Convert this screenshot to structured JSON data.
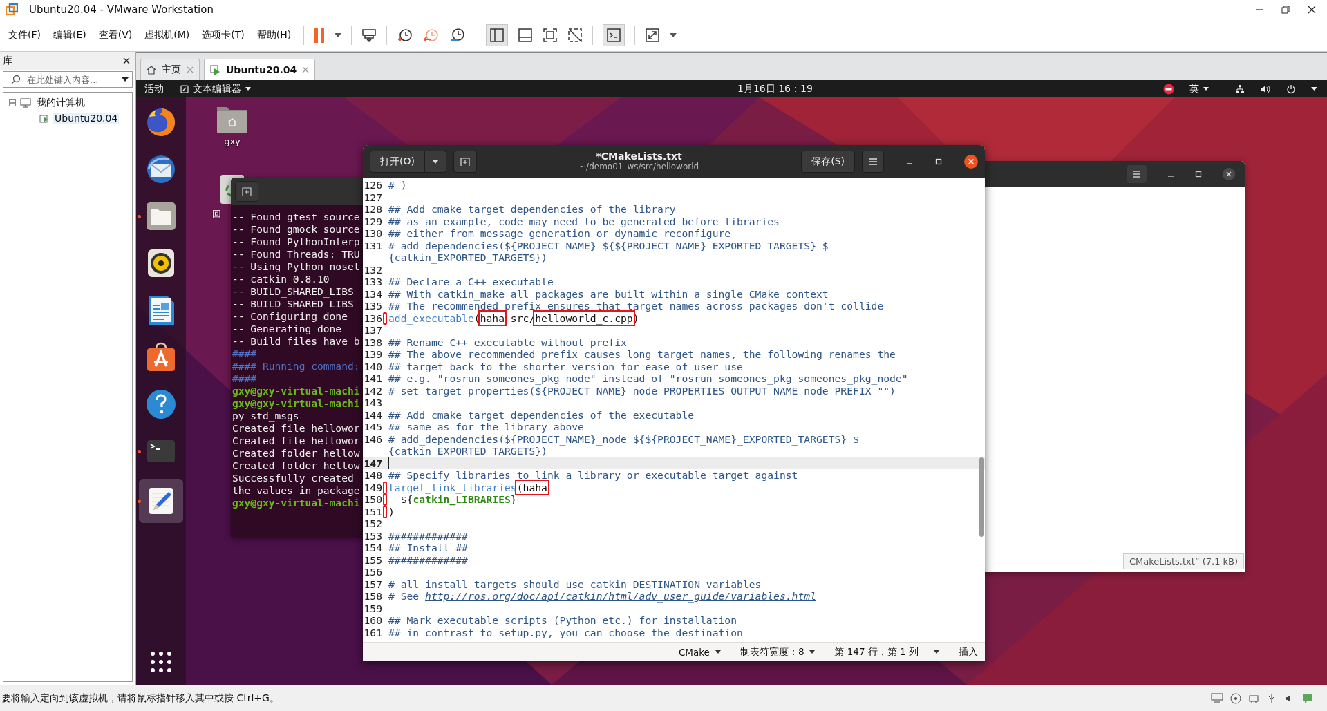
{
  "window": {
    "title": "Ubuntu20.04 - VMware Workstation"
  },
  "menu": [
    "文件(F)",
    "编辑(E)",
    "查看(V)",
    "虚拟机(M)",
    "选项卡(T)",
    "帮助(H)"
  ],
  "library": {
    "title": "库",
    "search": {
      "placeholder": "在此处键入内容..."
    },
    "tree": [
      {
        "label": "我的计算机",
        "expanded": true,
        "selected": false,
        "children": [
          {
            "label": "Ubuntu20.04",
            "selected": true
          }
        ]
      }
    ]
  },
  "tabs": [
    {
      "label": "主页",
      "kind": "home",
      "selected": false
    },
    {
      "label": "Ubuntu20.04",
      "kind": "vm",
      "selected": true
    }
  ],
  "guest": {
    "top_bar": {
      "activities": "活动",
      "app_menu": "文本编辑器",
      "clock": "1月16日 16：19",
      "input_method": "英"
    },
    "dock": [
      {
        "kind": "browser",
        "running": false,
        "selected": false
      },
      {
        "kind": "mail",
        "running": false,
        "selected": false
      },
      {
        "kind": "files",
        "running": true,
        "selected": false
      },
      {
        "kind": "music",
        "running": false,
        "selected": false
      },
      {
        "kind": "writer",
        "running": false,
        "selected": false
      },
      {
        "kind": "software",
        "running": false,
        "selected": false
      },
      {
        "kind": "help",
        "running": false,
        "selected": false
      },
      {
        "kind": "terminal",
        "running": true,
        "selected": false
      },
      {
        "kind": "editor",
        "running": true,
        "selected": true
      }
    ],
    "desktop_icons": [
      {
        "label": "gxy",
        "kind": "home"
      },
      {
        "label": "回",
        "kind": "trash"
      }
    ],
    "terminal": {
      "lines": [
        {
          "text": "-- Found gtest source",
          "kind": "output"
        },
        {
          "text": "-- Found gmock source",
          "kind": "output"
        },
        {
          "text": "-- Found PythonInterp",
          "kind": "output"
        },
        {
          "text": "-- Found Threads: TRU",
          "kind": "output"
        },
        {
          "text": "-- Using Python noset",
          "kind": "output"
        },
        {
          "text": "-- catkin 0.8.10",
          "kind": "output"
        },
        {
          "text": "-- BUILD_SHARED_LIBS",
          "kind": "output"
        },
        {
          "text": "-- BUILD_SHARED_LIBS",
          "kind": "output"
        },
        {
          "text": "-- Configuring done",
          "kind": "output"
        },
        {
          "text": "-- Generating done",
          "kind": "output"
        },
        {
          "text": "-- Build files have b",
          "kind": "output"
        },
        {
          "text": "####",
          "kind": "banner"
        },
        {
          "text": "#### Running command:",
          "kind": "banner"
        },
        {
          "text": "####",
          "kind": "banner"
        },
        {
          "text": "gxy@gxy-virtual-machi",
          "kind": "prompt"
        },
        {
          "text": "gxy@gxy-virtual-machi",
          "kind": "prompt"
        },
        {
          "text": "py std_msgs",
          "kind": "output"
        },
        {
          "text": "Created file hellowor",
          "kind": "output"
        },
        {
          "text": "Created file hellowor",
          "kind": "output"
        },
        {
          "text": "Created folder hellow",
          "kind": "output"
        },
        {
          "text": "Created folder hellow",
          "kind": "output"
        },
        {
          "text": "Successfully created",
          "kind": "output"
        },
        {
          "text": "the values in package",
          "kind": "output"
        },
        {
          "text": "gxy@gxy-virtual-machi",
          "kind": "prompt"
        }
      ]
    },
    "editor": {
      "title": "*CMakeLists.txt",
      "subtitle": "~/demo01_ws/src/helloworld",
      "open_button": "打开(O)",
      "save_button": "保存(S)",
      "lines": [
        {
          "num": "126",
          "current": false,
          "marked": false,
          "segments": [
            {
              "text": "# )",
              "kind": "comment"
            }
          ]
        },
        {
          "num": "127",
          "current": false,
          "marked": false
        },
        {
          "num": "128",
          "current": false,
          "marked": false,
          "segments": [
            {
              "text": "## Add cmake target dependencies of the library",
              "kind": "comment"
            }
          ]
        },
        {
          "num": "129",
          "current": false,
          "marked": false,
          "segments": [
            {
              "text": "## as an example, code may need to be generated before libraries",
              "kind": "comment"
            }
          ]
        },
        {
          "num": "130",
          "current": false,
          "marked": false,
          "segments": [
            {
              "text": "## either from message generation or dynamic reconfigure",
              "kind": "comment"
            }
          ]
        },
        {
          "num": "131",
          "current": false,
          "marked": false,
          "segments": [
            {
              "text": "# add_dependencies(${PROJECT_NAME} ${${PROJECT_NAME}_EXPORTED_TARGETS} $",
              "kind": "comment"
            }
          ],
          "wrap": "{catkin_EXPORTED_TARGETS})"
        },
        {
          "num": "132",
          "current": false,
          "marked": false
        },
        {
          "num": "133",
          "current": false,
          "marked": false,
          "segments": [
            {
              "text": "## Declare a C++ executable",
              "kind": "comment"
            }
          ]
        },
        {
          "num": "134",
          "current": false,
          "marked": false,
          "segments": [
            {
              "text": "## With catkin_make all packages are built within a single CMake context",
              "kind": "comment"
            }
          ]
        },
        {
          "num": "135",
          "current": false,
          "marked": false,
          "segments": [
            {
              "text": "## The recommended prefix ensures that target names across packages don't collide",
              "kind": "comment"
            }
          ]
        },
        {
          "num": "136",
          "current": false,
          "marked": true,
          "segments": [
            {
              "text": "add_executable",
              "kind": "function",
              "boxed": false
            },
            {
              "text": "(",
              "kind": "plain",
              "boxed": false
            },
            {
              "text": "haha",
              "kind": "plain",
              "boxed": true
            },
            {
              "text": " src/",
              "kind": "plain",
              "boxed": false
            },
            {
              "text": "helloworld_c.cpp",
              "kind": "plain",
              "boxed": true
            },
            {
              "text": ")",
              "kind": "plain",
              "boxed": false
            }
          ]
        },
        {
          "num": "137",
          "current": false,
          "marked": false
        },
        {
          "num": "138",
          "current": false,
          "marked": false,
          "segments": [
            {
              "text": "## Rename C++ executable without prefix",
              "kind": "comment"
            }
          ]
        },
        {
          "num": "139",
          "current": false,
          "marked": false,
          "segments": [
            {
              "text": "## The above recommended prefix causes long target names, the following renames the",
              "kind": "comment"
            }
          ]
        },
        {
          "num": "140",
          "current": false,
          "marked": false,
          "segments": [
            {
              "text": "## target back to the shorter version for ease of user use",
              "kind": "comment"
            }
          ]
        },
        {
          "num": "141",
          "current": false,
          "marked": false,
          "segments": [
            {
              "text": "## e.g. \"rosrun someones_pkg node\" instead of \"rosrun someones_pkg someones_pkg_node\"",
              "kind": "comment"
            }
          ]
        },
        {
          "num": "142",
          "current": false,
          "marked": false,
          "segments": [
            {
              "text": "# set_target_properties(${PROJECT_NAME}_node PROPERTIES OUTPUT_NAME node PREFIX \"\")",
              "kind": "comment"
            }
          ]
        },
        {
          "num": "143",
          "current": false,
          "marked": false
        },
        {
          "num": "144",
          "current": false,
          "marked": false,
          "segments": [
            {
              "text": "## Add cmake target dependencies of the executable",
              "kind": "comment"
            }
          ]
        },
        {
          "num": "145",
          "current": false,
          "marked": false,
          "segments": [
            {
              "text": "## same as for the library above",
              "kind": "comment"
            }
          ]
        },
        {
          "num": "146",
          "current": false,
          "marked": false,
          "segments": [
            {
              "text": "# add_dependencies(${PROJECT_NAME}_node ${${PROJECT_NAME}_EXPORTED_TARGETS} $",
              "kind": "comment"
            }
          ],
          "wrap": "{catkin_EXPORTED_TARGETS})"
        },
        {
          "num": "147",
          "current": true,
          "marked": false
        },
        {
          "num": "148",
          "current": false,
          "marked": false,
          "segments": [
            {
              "text": "## Specify libraries to link a library or executable target against",
              "kind": "comment"
            }
          ]
        },
        {
          "num": "149",
          "current": false,
          "marked": true,
          "segments": [
            {
              "text": "target_link_libraries",
              "kind": "function",
              "boxed": false
            },
            {
              "text": "(haha",
              "kind": "plain",
              "boxed": true
            }
          ]
        },
        {
          "num": "150",
          "current": false,
          "marked": true,
          "segments": [
            {
              "text": "  ${",
              "kind": "plain"
            },
            {
              "text": "catkin_LIBRARIES",
              "kind": "variable"
            },
            {
              "text": "}",
              "kind": "plain"
            }
          ]
        },
        {
          "num": "151",
          "current": false,
          "marked": true,
          "segments": [
            {
              "text": ")",
              "kind": "plain"
            }
          ]
        },
        {
          "num": "152",
          "current": false,
          "marked": false
        },
        {
          "num": "153",
          "current": false,
          "marked": false,
          "segments": [
            {
              "text": "#############",
              "kind": "comment"
            }
          ]
        },
        {
          "num": "154",
          "current": false,
          "marked": false,
          "segments": [
            {
              "text": "## Install ##",
              "kind": "comment"
            }
          ]
        },
        {
          "num": "155",
          "current": false,
          "marked": false,
          "segments": [
            {
              "text": "#############",
              "kind": "comment"
            }
          ]
        },
        {
          "num": "156",
          "current": false,
          "marked": false
        },
        {
          "num": "157",
          "current": false,
          "marked": false,
          "segments": [
            {
              "text": "# all install targets should use catkin DESTINATION variables",
              "kind": "comment"
            }
          ]
        },
        {
          "num": "158",
          "current": false,
          "marked": false,
          "segments": [
            {
              "text": "# See ",
              "kind": "comment"
            },
            {
              "text": "http://ros.org/doc/api/catkin/html/adv_user_guide/variables.html",
              "kind": "link"
            }
          ]
        },
        {
          "num": "159",
          "current": false,
          "marked": false
        },
        {
          "num": "160",
          "current": false,
          "marked": false,
          "segments": [
            {
              "text": "## Mark executable scripts (Python etc.) for installation",
              "kind": "comment"
            }
          ]
        },
        {
          "num": "161",
          "current": false,
          "marked": false,
          "segments": [
            {
              "text": "## in contrast to setup.py, you can choose the destination",
              "kind": "comment"
            }
          ]
        }
      ],
      "status": {
        "language": "CMake",
        "tab_width": "制表符宽度：8",
        "position": "第 147 行，第 1 列",
        "mode": "插入"
      }
    },
    "background_window": {
      "status": "CMakeLists.txt” (7.1 kB)"
    }
  },
  "status_bar": {
    "message": "要将输入定向到该虚拟机，请将鼠标指针移入其中或按 Ctrl+G。"
  }
}
